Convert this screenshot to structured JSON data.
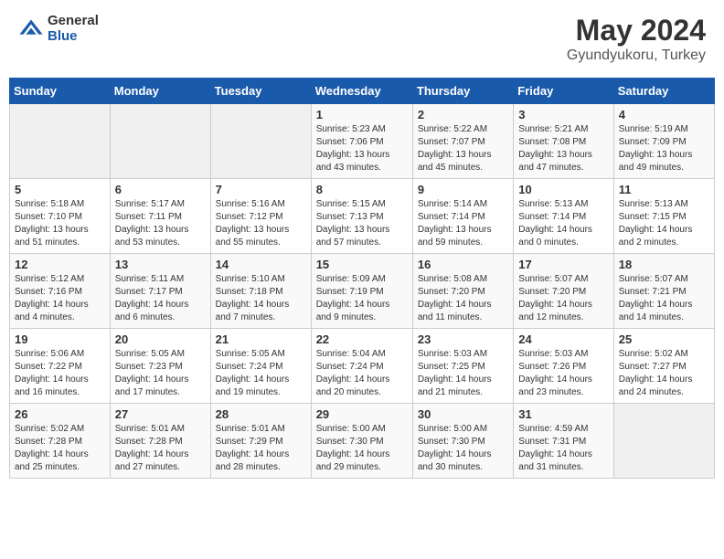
{
  "header": {
    "logo_general": "General",
    "logo_blue": "Blue",
    "title": "May 2024",
    "subtitle": "Gyundyukoru, Turkey"
  },
  "days_of_week": [
    "Sunday",
    "Monday",
    "Tuesday",
    "Wednesday",
    "Thursday",
    "Friday",
    "Saturday"
  ],
  "weeks": [
    [
      {
        "day": "",
        "info": ""
      },
      {
        "day": "",
        "info": ""
      },
      {
        "day": "",
        "info": ""
      },
      {
        "day": "1",
        "info": "Sunrise: 5:23 AM\nSunset: 7:06 PM\nDaylight: 13 hours\nand 43 minutes."
      },
      {
        "day": "2",
        "info": "Sunrise: 5:22 AM\nSunset: 7:07 PM\nDaylight: 13 hours\nand 45 minutes."
      },
      {
        "day": "3",
        "info": "Sunrise: 5:21 AM\nSunset: 7:08 PM\nDaylight: 13 hours\nand 47 minutes."
      },
      {
        "day": "4",
        "info": "Sunrise: 5:19 AM\nSunset: 7:09 PM\nDaylight: 13 hours\nand 49 minutes."
      }
    ],
    [
      {
        "day": "5",
        "info": "Sunrise: 5:18 AM\nSunset: 7:10 PM\nDaylight: 13 hours\nand 51 minutes."
      },
      {
        "day": "6",
        "info": "Sunrise: 5:17 AM\nSunset: 7:11 PM\nDaylight: 13 hours\nand 53 minutes."
      },
      {
        "day": "7",
        "info": "Sunrise: 5:16 AM\nSunset: 7:12 PM\nDaylight: 13 hours\nand 55 minutes."
      },
      {
        "day": "8",
        "info": "Sunrise: 5:15 AM\nSunset: 7:13 PM\nDaylight: 13 hours\nand 57 minutes."
      },
      {
        "day": "9",
        "info": "Sunrise: 5:14 AM\nSunset: 7:14 PM\nDaylight: 13 hours\nand 59 minutes."
      },
      {
        "day": "10",
        "info": "Sunrise: 5:13 AM\nSunset: 7:14 PM\nDaylight: 14 hours\nand 0 minutes."
      },
      {
        "day": "11",
        "info": "Sunrise: 5:13 AM\nSunset: 7:15 PM\nDaylight: 14 hours\nand 2 minutes."
      }
    ],
    [
      {
        "day": "12",
        "info": "Sunrise: 5:12 AM\nSunset: 7:16 PM\nDaylight: 14 hours\nand 4 minutes."
      },
      {
        "day": "13",
        "info": "Sunrise: 5:11 AM\nSunset: 7:17 PM\nDaylight: 14 hours\nand 6 minutes."
      },
      {
        "day": "14",
        "info": "Sunrise: 5:10 AM\nSunset: 7:18 PM\nDaylight: 14 hours\nand 7 minutes."
      },
      {
        "day": "15",
        "info": "Sunrise: 5:09 AM\nSunset: 7:19 PM\nDaylight: 14 hours\nand 9 minutes."
      },
      {
        "day": "16",
        "info": "Sunrise: 5:08 AM\nSunset: 7:20 PM\nDaylight: 14 hours\nand 11 minutes."
      },
      {
        "day": "17",
        "info": "Sunrise: 5:07 AM\nSunset: 7:20 PM\nDaylight: 14 hours\nand 12 minutes."
      },
      {
        "day": "18",
        "info": "Sunrise: 5:07 AM\nSunset: 7:21 PM\nDaylight: 14 hours\nand 14 minutes."
      }
    ],
    [
      {
        "day": "19",
        "info": "Sunrise: 5:06 AM\nSunset: 7:22 PM\nDaylight: 14 hours\nand 16 minutes."
      },
      {
        "day": "20",
        "info": "Sunrise: 5:05 AM\nSunset: 7:23 PM\nDaylight: 14 hours\nand 17 minutes."
      },
      {
        "day": "21",
        "info": "Sunrise: 5:05 AM\nSunset: 7:24 PM\nDaylight: 14 hours\nand 19 minutes."
      },
      {
        "day": "22",
        "info": "Sunrise: 5:04 AM\nSunset: 7:24 PM\nDaylight: 14 hours\nand 20 minutes."
      },
      {
        "day": "23",
        "info": "Sunrise: 5:03 AM\nSunset: 7:25 PM\nDaylight: 14 hours\nand 21 minutes."
      },
      {
        "day": "24",
        "info": "Sunrise: 5:03 AM\nSunset: 7:26 PM\nDaylight: 14 hours\nand 23 minutes."
      },
      {
        "day": "25",
        "info": "Sunrise: 5:02 AM\nSunset: 7:27 PM\nDaylight: 14 hours\nand 24 minutes."
      }
    ],
    [
      {
        "day": "26",
        "info": "Sunrise: 5:02 AM\nSunset: 7:28 PM\nDaylight: 14 hours\nand 25 minutes."
      },
      {
        "day": "27",
        "info": "Sunrise: 5:01 AM\nSunset: 7:28 PM\nDaylight: 14 hours\nand 27 minutes."
      },
      {
        "day": "28",
        "info": "Sunrise: 5:01 AM\nSunset: 7:29 PM\nDaylight: 14 hours\nand 28 minutes."
      },
      {
        "day": "29",
        "info": "Sunrise: 5:00 AM\nSunset: 7:30 PM\nDaylight: 14 hours\nand 29 minutes."
      },
      {
        "day": "30",
        "info": "Sunrise: 5:00 AM\nSunset: 7:30 PM\nDaylight: 14 hours\nand 30 minutes."
      },
      {
        "day": "31",
        "info": "Sunrise: 4:59 AM\nSunset: 7:31 PM\nDaylight: 14 hours\nand 31 minutes."
      },
      {
        "day": "",
        "info": ""
      }
    ]
  ]
}
